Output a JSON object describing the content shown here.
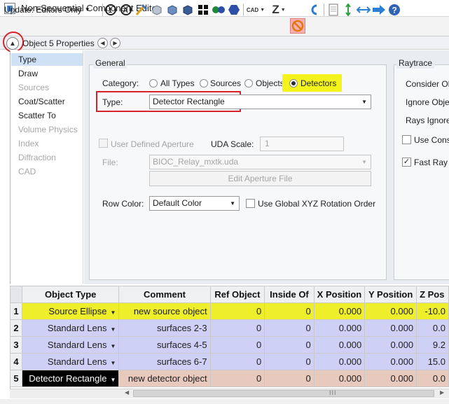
{
  "window": {
    "title": "Non-Sequential Component Editor"
  },
  "toolbar": {
    "update_label": "Update: Editors Only",
    "cad_label": "CAD",
    "z_label": "Z",
    "icons": [
      "solve-icon",
      "refresh-icon",
      "glass-icon",
      "cube-gray-icon",
      "cube-blue-icon",
      "cube-dark-icon",
      "grid-icon",
      "dual-sphere-icon",
      "hexagon-icon",
      "cad-icon",
      "z-icon",
      "stop-icon",
      "undo-icon",
      "page-icon",
      "split-arrows-icon",
      "join-arrows-icon",
      "right-arrow-icon",
      "help-icon"
    ]
  },
  "properties_bar": {
    "title": "Object 5 Properties"
  },
  "left_tree": {
    "items": [
      {
        "label": "Type",
        "enabled": true,
        "selected": true
      },
      {
        "label": "Draw",
        "enabled": true
      },
      {
        "label": "Sources",
        "enabled": false
      },
      {
        "label": "Coat/Scatter",
        "enabled": true
      },
      {
        "label": "Scatter To",
        "enabled": true
      },
      {
        "label": "Volume Physics",
        "enabled": false
      },
      {
        "label": "Index",
        "enabled": false
      },
      {
        "label": "Diffraction",
        "enabled": false
      },
      {
        "label": "CAD",
        "enabled": false
      }
    ]
  },
  "general": {
    "group_label": "General",
    "category_label": "Category:",
    "categories": [
      "All Types",
      "Sources",
      "Objects",
      "Detectors"
    ],
    "selected_category": "Detectors",
    "type_label": "Type:",
    "type_value": "Detector Rectangle",
    "uda_label": "User Defined Aperture",
    "uda_scale_label": "UDA Scale:",
    "uda_scale_value": "1",
    "file_label": "File:",
    "file_value": "BIOC_Relay_mxtk.uda",
    "edit_aperture_label": "Edit Aperture File",
    "row_color_label": "Row Color:",
    "row_color_value": "Default Color",
    "global_rotation_label": "Use Global XYZ Rotation Order"
  },
  "raytrace": {
    "group_label": "Raytrace",
    "consider_label": "Consider Ob",
    "ignore_label": "Ignore Obje",
    "rays_ignore_label": "Rays Ignore",
    "use_cons_label": "Use Cons",
    "fast_ray_label": "Fast Ray T"
  },
  "grid": {
    "columns": [
      "Object Type",
      "Comment",
      "Ref Object",
      "Inside Of",
      "X Position",
      "Y Position",
      "Z Pos"
    ],
    "rows": [
      {
        "n": "1",
        "type": "Source Ellipse",
        "comment": "new source object",
        "ref": "0",
        "inside": "0",
        "x": "0.000",
        "y": "0.000",
        "z": "-10.0"
      },
      {
        "n": "2",
        "type": "Standard Lens",
        "comment": "surfaces 2-3",
        "ref": "0",
        "inside": "0",
        "x": "0.000",
        "y": "0.000",
        "z": "0.0"
      },
      {
        "n": "3",
        "type": "Standard Lens",
        "comment": "surfaces 4-5",
        "ref": "0",
        "inside": "0",
        "x": "0.000",
        "y": "0.000",
        "z": "9.2"
      },
      {
        "n": "4",
        "type": "Standard Lens",
        "comment": "surfaces 6-7",
        "ref": "0",
        "inside": "0",
        "x": "0.000",
        "y": "0.000",
        "z": "15.0"
      },
      {
        "n": "5",
        "type": "Detector Rectangle",
        "comment": "new detector object",
        "ref": "0",
        "inside": "0",
        "x": "0.000",
        "y": "0.000",
        "z": "0.0"
      }
    ],
    "scroll_grip": "III"
  },
  "colors": {
    "highlight_yellow": "#f4f41a",
    "annotation_red": "#d9232a",
    "row_source": "#eeee2a",
    "row_lens": "#cfd0f5",
    "row_detector": "#e8c9bd"
  }
}
